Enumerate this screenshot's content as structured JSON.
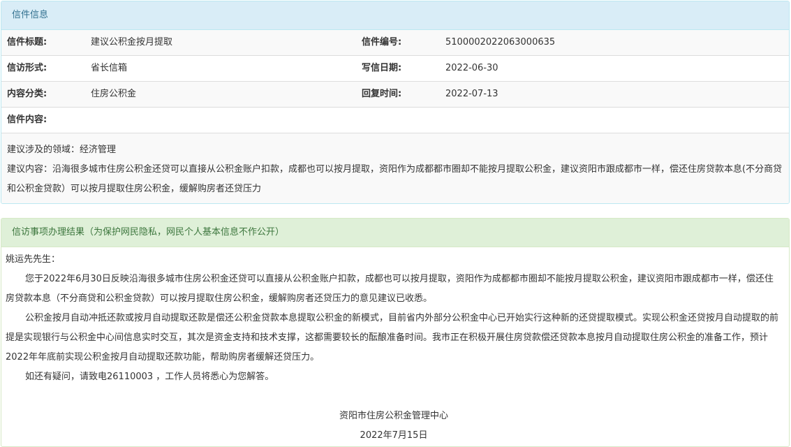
{
  "letter_panel": {
    "heading": "信件信息",
    "rows": [
      {
        "label": "信件标题:",
        "value": "建议公积金按月提取",
        "label2": "信件编号:",
        "value2": "5100002022063000635"
      },
      {
        "label": "信访形式:",
        "value": "省长信箱",
        "label2": "写信日期:",
        "value2": "2022-06-30"
      },
      {
        "label": "内容分类:",
        "value": "住房公积金",
        "label2": "回复时间:",
        "value2": "2022-07-13"
      }
    ],
    "content_label": "信件内容:",
    "content_lines": [
      "建议涉及的领域：经济管理",
      "建议内容：沿海很多城市住房公积金还贷可以直接从公积金账户扣款，成都也可以按月提取，资阳作为成都都市圈却不能按月提取公积金，建议资阳市跟成都市一样，偿还住房贷款本息(不分商贷和公积金贷款）可以按月提取住房公积金，缓解购房者还贷压力"
    ]
  },
  "reply_panel": {
    "heading": "信访事项办理结果（为保护网民隐私，网民个人基本信息不作公开）",
    "greeting": "姚运先先生：",
    "paragraphs": [
      "您于2022年6月30日反映沿海很多城市住房公积金还贷可以直接从公积金账户扣款，成都也可以按月提取，资阳作为成都都市圈却不能按月提取公积金，建议资阳市跟成都市一样，偿还住房贷款本息（不分商贷和公积金贷款）可以按月提取住房公积金，缓解购房者还贷压力的意见建议已收悉。",
      "公积金按月自动冲抵还款或按月自动提取还款是偿还公积金贷款本息提取公积金的新模式，目前省内外部分公积金中心已开始实行这种新的还贷提取模式。实现公积金还贷按月自动提取的前提是实现银行与公积金中心间信息实时交互，其次是资金支持和技术支撑，这都需要较长的酝酿准备时间。我市正在积极开展住房贷款偿还贷款本息按月自动提取住房公积金的准备工作，预计2022年年底前实现公积金按月自动提取还款功能，帮助购房者缓解还贷压力。",
      "如还有疑问，请致电26110003 ，工作人员将悉心为您解答。"
    ],
    "signature": "资阳市住房公积金管理中心",
    "date": "2022年7月15日"
  }
}
